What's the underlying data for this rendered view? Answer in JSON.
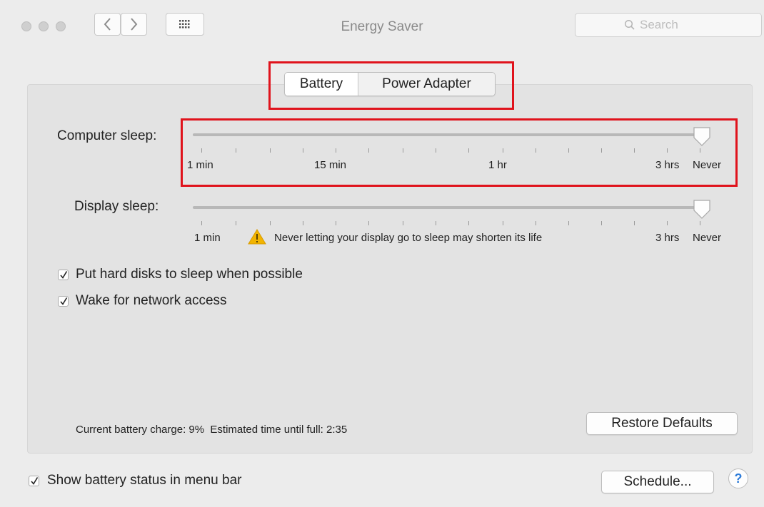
{
  "window": {
    "title": "Energy Saver",
    "search_placeholder": "Search"
  },
  "tabs": [
    "Battery",
    "Power Adapter"
  ],
  "computer_sleep": {
    "label": "Computer sleep:",
    "value": "Never",
    "tick_labels": [
      "1 min",
      "15 min",
      "1 hr",
      "3 hrs",
      "Never"
    ]
  },
  "display_sleep": {
    "label": "Display sleep:",
    "value": "Never",
    "tick_labels": [
      "1 min",
      "3 hrs",
      "Never"
    ],
    "warning": "Never letting your display go to sleep may shorten its life"
  },
  "options": [
    {
      "label": "Put hard disks to sleep when possible",
      "checked": true
    },
    {
      "label": "Wake for network access",
      "checked": true
    }
  ],
  "status": "Current battery charge: 9%  Estimated time until full: 2:35",
  "restore_defaults": "Restore Defaults",
  "show_battery_status": {
    "label": "Show battery status in menu bar",
    "checked": true
  },
  "schedule": "Schedule...",
  "help": "?",
  "colors": {
    "highlight": "#e0131c",
    "warning": "#f2b400",
    "help_blue": "#2e7cd9"
  }
}
